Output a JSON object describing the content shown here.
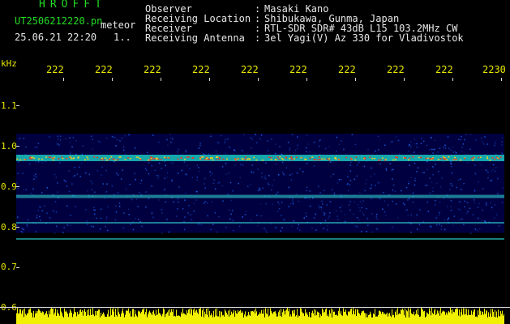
{
  "header": {
    "brand": "HROFFT",
    "filename": "UT2506212220.pn",
    "tag": "meteor",
    "datetime": "25.06.21 22:20",
    "datetime_extra": "1..",
    "info": [
      {
        "label": "Observer",
        "value": "Masaki Kano"
      },
      {
        "label": "Receiving Location",
        "value": "Shibukawa, Gunma, Japan"
      },
      {
        "label": "Receiver",
        "value": "RTL-SDR SDR# 43dB L15 103.2MHz CW"
      },
      {
        "label": "Receiving Antenna",
        "value": "3el Yagi(V) Az 330 for Vladivostok"
      }
    ]
  },
  "chart_data": {
    "type": "heatmap",
    "ylabel": "kHz",
    "y_ticks": [
      "1.1",
      "1.0",
      "0.9",
      "0.8",
      "0.7",
      "0.6"
    ],
    "x_ticks": [
      "222",
      "222",
      "222",
      "222",
      "222",
      "222",
      "222",
      "222",
      "222",
      "2230"
    ],
    "ylim": [
      0.6,
      1.15
    ],
    "bands_khz": [
      0.97,
      0.875,
      0.81,
      0.77
    ],
    "colors": {
      "label": "#e8e800",
      "tick": "#d8d8d8",
      "low": "#000040",
      "mid": "#1e6cff",
      "high": "#ff2a1a",
      "amplitude": "#f0f000"
    }
  }
}
